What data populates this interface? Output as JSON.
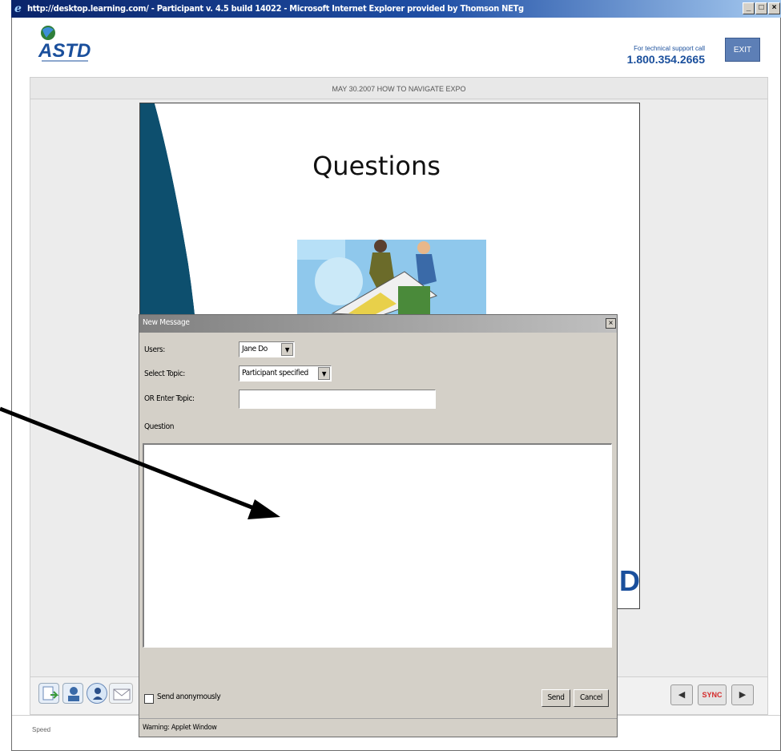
{
  "browser": {
    "title": "http://desktop.learning.com/ - Participant v. 4.5 build 14022 - Microsoft Internet Explorer provided by Thomson NETg",
    "min_label": "_",
    "max_label": "□",
    "close_label": "×"
  },
  "header": {
    "logo_text": "ASTD",
    "support_label": "For technical support call",
    "support_phone": "1.800.354.2665",
    "exit_label": "EXIT"
  },
  "session": {
    "title": "MAY 30.2007 HOW TO NAVIGATE EXPO"
  },
  "slide": {
    "title": "Questions",
    "logo_fragment": "D"
  },
  "dialog": {
    "title": "New Message",
    "close_label": "×",
    "users_label": "Users:",
    "users_value": "Jane Do",
    "topic_label": "Select Topic:",
    "topic_value": "Participant specified",
    "enter_topic_label": "OR Enter Topic:",
    "enter_topic_value": "",
    "question_label": "Question",
    "question_value": "",
    "anonymous_label": "Send anonymously",
    "send_label": "Send",
    "cancel_label": "Cancel",
    "warning": "Warning: Applet Window"
  },
  "toolbar": {
    "sync_label": "SYNC",
    "prev_label": "◀",
    "next_label": "▶"
  },
  "status": {
    "text": "Speed"
  },
  "colors": {
    "brand_blue": "#1a4f9c",
    "sync_red": "#d42a2a",
    "titlebar": "#0a246a"
  }
}
